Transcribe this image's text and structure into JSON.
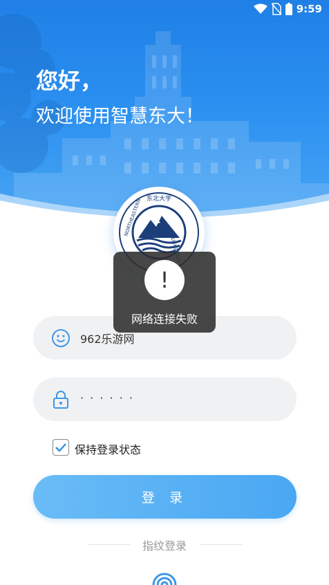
{
  "status_bar": {
    "time": "9:59",
    "icons": [
      "wifi-icon",
      "no-sim-icon",
      "battery-icon"
    ]
  },
  "header": {
    "greeting": "您好，",
    "welcome": "欢迎使用智慧东大！"
  },
  "logo": {
    "left_text": "NORTHEASTERN",
    "right_text": "UNIVERSITY",
    "top_text": "东北大学"
  },
  "form": {
    "username": {
      "value": "962乐游网",
      "icon": "smile-icon"
    },
    "password": {
      "value": "· · · · · ·",
      "icon": "lock-icon"
    },
    "remember": {
      "label": "保持登录状态",
      "checked": true
    },
    "login_label": "登 录",
    "fingerprint_label": "指纹登录"
  },
  "toast": {
    "icon": "!",
    "message": "网络连接失败"
  },
  "colors": {
    "primary": "#2a8ff0",
    "button": "#5ab2f5"
  }
}
